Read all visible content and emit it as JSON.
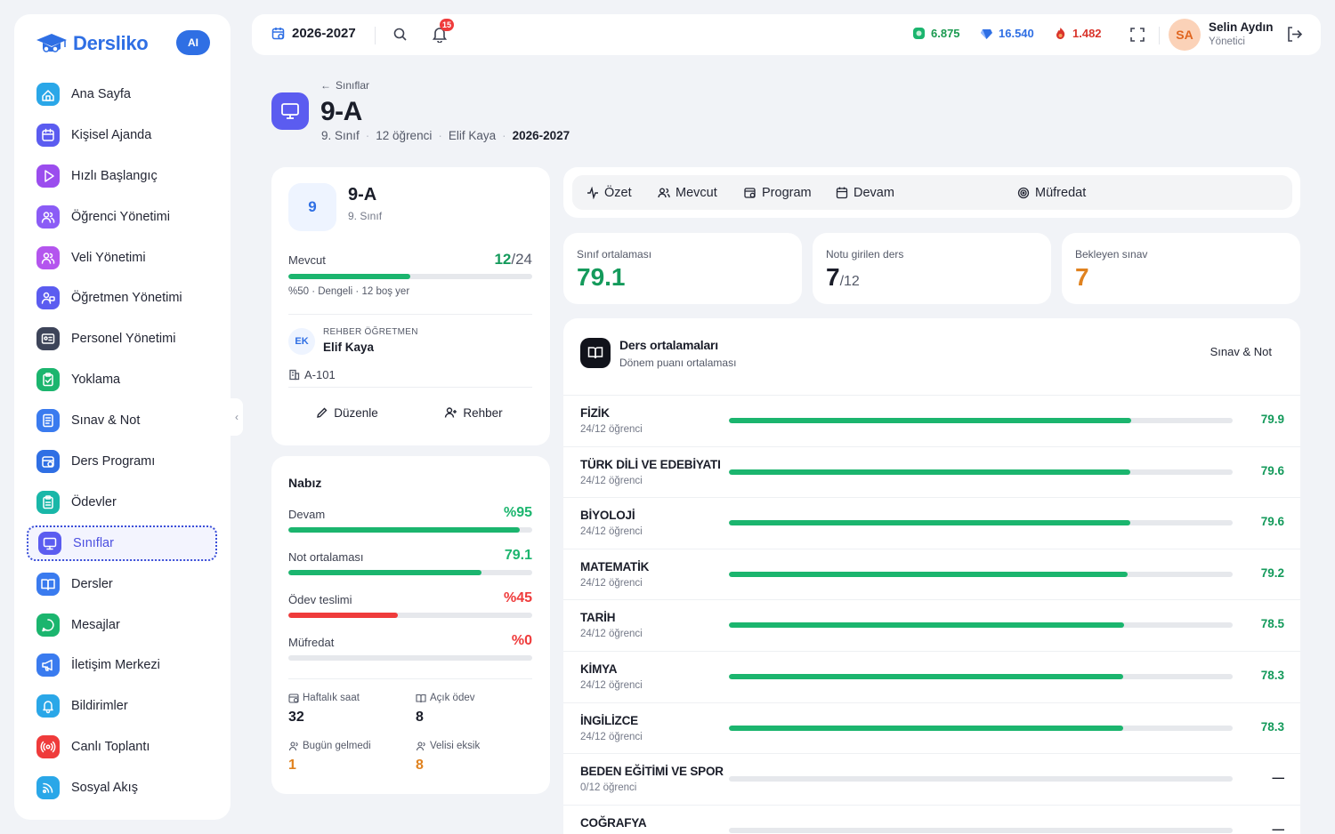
{
  "app": {
    "brand": "Dersliko",
    "ai_label": "AI"
  },
  "sidebar": {
    "items": [
      {
        "label": "Ana Sayfa",
        "icon": "home-icon",
        "color": "#2aa7e8"
      },
      {
        "label": "Kişisel Ajanda",
        "icon": "calendar-icon",
        "color": "#5b5cf0"
      },
      {
        "label": "Hızlı Başlangıç",
        "icon": "play-icon",
        "color": "#9b4dee"
      },
      {
        "label": "Öğrenci Yönetimi",
        "icon": "users-icon",
        "color": "#8b5cf6"
      },
      {
        "label": "Veli Yönetimi",
        "icon": "users-icon",
        "color": "#b455ee"
      },
      {
        "label": "Öğretmen Yönetimi",
        "icon": "teacher-icon",
        "color": "#5b5cf0"
      },
      {
        "label": "Personel Yönetimi",
        "icon": "id-card-icon",
        "color": "#3d4459"
      },
      {
        "label": "Yoklama",
        "icon": "clipboard-check-icon",
        "color": "#1bb56e"
      },
      {
        "label": "Sınav & Not",
        "icon": "document-icon",
        "color": "#3a7bef"
      },
      {
        "label": "Ders Programı",
        "icon": "calendar-clock-icon",
        "color": "#2f6fe4"
      },
      {
        "label": "Ödevler",
        "icon": "clipboard-icon",
        "color": "#19b7a8"
      },
      {
        "label": "Sınıflar",
        "icon": "presentation-icon",
        "color": "#5b5cf0",
        "active": true
      },
      {
        "label": "Dersler",
        "icon": "book-icon",
        "color": "#3a7bef"
      },
      {
        "label": "Mesajlar",
        "icon": "chat-icon",
        "color": "#1bb56e"
      },
      {
        "label": "İletişim Merkezi",
        "icon": "megaphone-icon",
        "color": "#3a7bef"
      },
      {
        "label": "Bildirimler",
        "icon": "bell-icon",
        "color": "#2aa7e8"
      },
      {
        "label": "Canlı Toplantı",
        "icon": "broadcast-icon",
        "color": "#ef3b3b"
      },
      {
        "label": "Sosyal Akış",
        "icon": "rss-icon",
        "color": "#2aa7e8"
      }
    ]
  },
  "topbar": {
    "year": "2026-2027",
    "notification_count": "15",
    "stats": [
      {
        "value": "6.875",
        "color": "#1b9a50"
      },
      {
        "value": "16.540",
        "color": "#2f6fe4"
      },
      {
        "value": "1.482",
        "color": "#d9342b"
      }
    ],
    "user": {
      "initials": "SA",
      "name": "Selin Aydın",
      "role": "Yönetici"
    }
  },
  "page": {
    "back_label": "Sınıflar",
    "title": "9-A",
    "meta": {
      "grade": "9. Sınıf",
      "students": "12 öğrenci",
      "teacher": "Elif Kaya",
      "year": "2026-2027"
    }
  },
  "class_card": {
    "badge": "9",
    "name": "9-A",
    "grade": "9. Sınıf",
    "capacity_label": "Mevcut",
    "capacity_current": "12",
    "capacity_total": "/24",
    "capacity_fraction": 0.5,
    "capacity_note": "%50 · Dengeli · 12 boş yer",
    "teacher_initials": "EK",
    "teacher_role": "REHBER ÖĞRETMEN",
    "teacher_name": "Elif Kaya",
    "room": "A-101",
    "edit_label": "Düzenle",
    "guide_label": "Rehber"
  },
  "pulse": {
    "title": "Nabız",
    "metrics": [
      {
        "label": "Devam",
        "value": "%95",
        "fraction": 0.95,
        "color": "#1bb56e"
      },
      {
        "label": "Not ortalaması",
        "value": "79.1",
        "fraction": 0.791,
        "color": "#1bb56e"
      },
      {
        "label": "Ödev teslimi",
        "value": "%45",
        "fraction": 0.45,
        "color": "#ef3b3b"
      },
      {
        "label": "Müfredat",
        "value": "%0",
        "fraction": 0,
        "color": "#ef3b3b"
      }
    ],
    "facts": [
      {
        "label": "Haftalık saat",
        "value": "32",
        "color": "#1a1d29"
      },
      {
        "label": "Açık ödev",
        "value": "8",
        "color": "#1a1d29"
      },
      {
        "label": "Bugün gelmedi",
        "value": "1",
        "color": "#e0821f"
      },
      {
        "label": "Velisi eksik",
        "value": "8",
        "color": "#e0821f"
      }
    ]
  },
  "tabs": [
    {
      "label": "Özet"
    },
    {
      "label": "Mevcut"
    },
    {
      "label": "Program"
    },
    {
      "label": "Devam"
    },
    {
      "label": "Müfredat"
    }
  ],
  "summary_cards": [
    {
      "label": "Sınıf ortalaması",
      "value": "79.1",
      "suffix": "",
      "color": "#149a5b"
    },
    {
      "label": "Notu girilen ders",
      "value": "7",
      "suffix": "/12",
      "color": "#1a1d29"
    },
    {
      "label": "Bekleyen sınav",
      "value": "7",
      "suffix": "",
      "color": "#e0821f"
    }
  ],
  "averages": {
    "title": "Ders ortalamaları",
    "subtitle": "Dönem puanı ortalaması",
    "action_label": "Sınav & Not",
    "subjects": [
      {
        "name": "FİZİK",
        "count": "24/12 öğrenci",
        "value": "79.9",
        "fraction": 0.799
      },
      {
        "name": "TÜRK DİLİ VE EDEBİYATI",
        "count": "24/12 öğrenci",
        "value": "79.6",
        "fraction": 0.796
      },
      {
        "name": "BİYOLOJİ",
        "count": "24/12 öğrenci",
        "value": "79.6",
        "fraction": 0.796
      },
      {
        "name": "MATEMATİK",
        "count": "24/12 öğrenci",
        "value": "79.2",
        "fraction": 0.792
      },
      {
        "name": "TARİH",
        "count": "24/12 öğrenci",
        "value": "78.5",
        "fraction": 0.785
      },
      {
        "name": "KİMYA",
        "count": "24/12 öğrenci",
        "value": "78.3",
        "fraction": 0.783
      },
      {
        "name": "İNGİLİZCE",
        "count": "24/12 öğrenci",
        "value": "78.3",
        "fraction": 0.783
      },
      {
        "name": "BEDEN EĞİTİMİ VE SPOR",
        "count": "0/12 öğrenci",
        "value": "—",
        "fraction": 0
      },
      {
        "name": "COĞRAFYA",
        "count": "",
        "value": "—",
        "fraction": 0
      }
    ]
  }
}
